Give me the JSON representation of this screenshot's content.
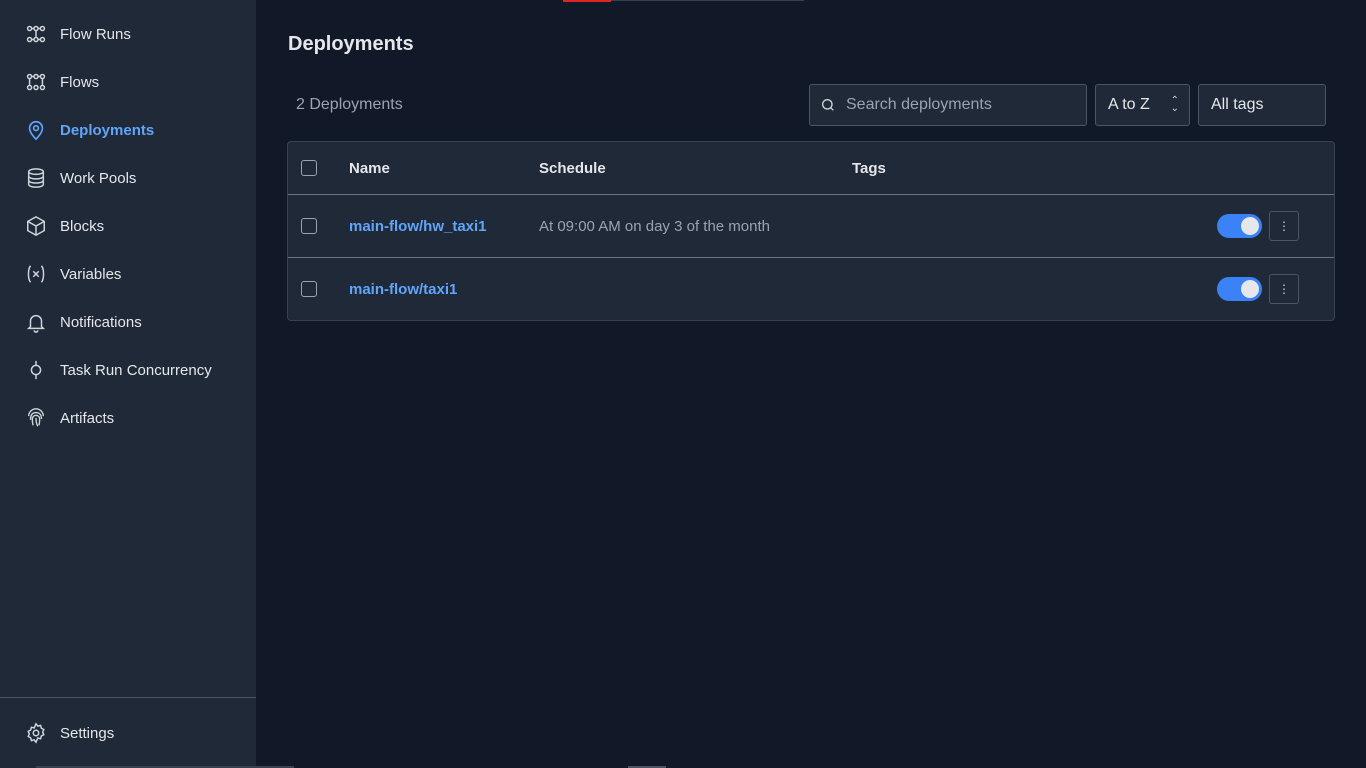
{
  "sidebar": {
    "items": [
      {
        "label": "Flow Runs",
        "icon": "flow-runs-icon"
      },
      {
        "label": "Flows",
        "icon": "flows-icon"
      },
      {
        "label": "Deployments",
        "icon": "map-pin-icon",
        "active": true
      },
      {
        "label": "Work Pools",
        "icon": "database-icon"
      },
      {
        "label": "Blocks",
        "icon": "cube-icon"
      },
      {
        "label": "Variables",
        "icon": "variable-icon"
      },
      {
        "label": "Notifications",
        "icon": "bell-icon"
      },
      {
        "label": "Task Run Concurrency",
        "icon": "concurrency-icon"
      },
      {
        "label": "Artifacts",
        "icon": "fingerprint-icon"
      }
    ],
    "settings_label": "Settings"
  },
  "main": {
    "title": "Deployments",
    "count_text": "2 Deployments",
    "search": {
      "placeholder": "Search deployments",
      "value": ""
    },
    "sort": {
      "selected": "A to Z"
    },
    "tags": {
      "selected": "All tags"
    },
    "table": {
      "columns": [
        "Name",
        "Schedule",
        "Tags"
      ],
      "rows": [
        {
          "name": "main-flow/hw_taxi1",
          "schedule": "At 09:00 AM on day 3 of the month",
          "tags": "",
          "active": true
        },
        {
          "name": "main-flow/taxi1",
          "schedule": "",
          "tags": "",
          "active": true
        }
      ]
    }
  },
  "colors": {
    "accent": "#60a5fa",
    "toggle": "#3b82f6",
    "sidebar_bg": "#1f2937",
    "page_bg": "#111827"
  }
}
